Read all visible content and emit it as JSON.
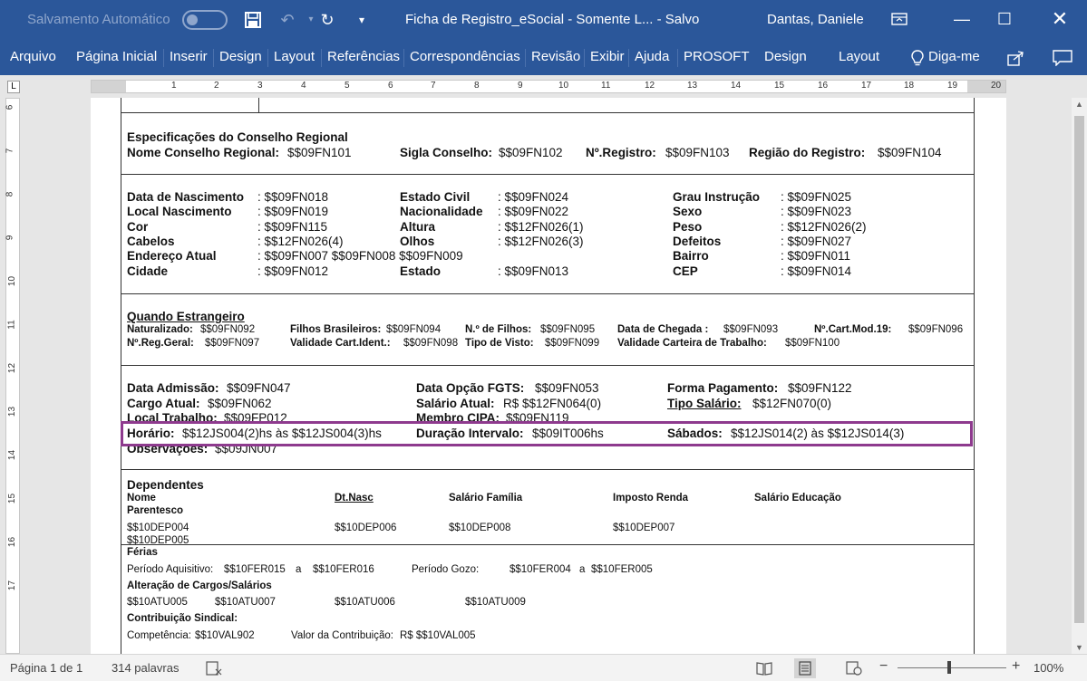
{
  "titlebar": {
    "autosave_label": "Salvamento Automático",
    "doc_title": "Ficha de Registro_eSocial  -  Somente L...  -  Salvo",
    "user": "Dantas, Daniele",
    "save_icon": "save-icon",
    "undo_icon": "undo-icon",
    "redo_icon": "redo-icon",
    "qat_more_icon": "customize-qat-icon"
  },
  "tabs": [
    "Arquivo",
    "Página Inicial",
    "Inserir",
    "Design",
    "Layout",
    "Referências",
    "Correspondências",
    "Revisão",
    "Exibir",
    "Ajuda",
    "PROSOFT",
    "Design",
    "Layout"
  ],
  "tell_me": "Diga-me",
  "ruler": {
    "h_numbers": [
      "1",
      "2",
      "3",
      "4",
      "5",
      "6",
      "7",
      "8",
      "9",
      "10",
      "11",
      "12",
      "13",
      "14",
      "15",
      "16",
      "17",
      "18",
      "19",
      "20"
    ],
    "v_numbers": [
      "6",
      "7",
      "8",
      "9",
      "10",
      "11",
      "12",
      "13",
      "14",
      "15",
      "16",
      "17"
    ]
  },
  "conselho": {
    "title": "Especificações do Conselho Regional",
    "nome_label": "Nome Conselho Regional:",
    "nome_value": "$$09FN101",
    "sigla_label": "Sigla Conselho:",
    "sigla_value": "$$09FN102",
    "registro_label": "Nº.Registro:",
    "registro_value": "$$09FN103",
    "regiao_label": "Região do Registro:",
    "regiao_value": "$$09FN104"
  },
  "pessoais": {
    "col1": [
      {
        "label": "Data de Nascimento",
        "value": ": $$09FN018"
      },
      {
        "label": "Local Nascimento",
        "value": ": $$09FN019"
      },
      {
        "label": "Cor",
        "value": ": $$09FN115"
      },
      {
        "label": "Cabelos",
        "value": ": $$12FN026(4)"
      },
      {
        "label": "Endereço Atual",
        "value": ": $$09FN007 $$09FN008 $$09FN009"
      },
      {
        "label": "Cidade",
        "value": ": $$09FN012"
      }
    ],
    "col2": [
      {
        "label": "Estado Civil",
        "value": ": $$09FN024"
      },
      {
        "label": "Nacionalidade",
        "value": ": $$09FN022"
      },
      {
        "label": "Altura",
        "value": ": $$12FN026(1)"
      },
      {
        "label": "Olhos",
        "value": ": $$12FN026(3)"
      },
      {
        "label": "Estado",
        "value": ": $$09FN013"
      }
    ],
    "col3": [
      {
        "label": "Grau Instrução",
        "value": ": $$09FN025"
      },
      {
        "label": "Sexo",
        "value": ": $$09FN023"
      },
      {
        "label": "Peso",
        "value": ": $$12FN026(2)"
      },
      {
        "label": "Defeitos",
        "value": ": $$09FN027"
      },
      {
        "label": "Bairro",
        "value": ": $$09FN011"
      },
      {
        "label": "CEP",
        "value": ": $$09FN014"
      }
    ]
  },
  "estrangeiro": {
    "title": "Quando Estrangeiro",
    "naturalizado_label": "Naturalizado:",
    "naturalizado_value": "$$09FN092",
    "filhos_br_label": "Filhos Brasileiros:",
    "filhos_br_value": "$$09FN094",
    "num_filhos_label": "N.º de Filhos:",
    "num_filhos_value": "$$09FN095",
    "chegada_label": "Data de Chegada :",
    "chegada_value": "$$09FN093",
    "cart_label": "Nº.Cart.Mod.19:",
    "cart_value": "$$09FN096",
    "reg_geral_label": "Nº.Reg.Geral:",
    "reg_geral_value": "$$09FN097",
    "validade_ident_label": "Validade Cart.Ident.:",
    "validade_ident_value": "$$09FN098",
    "tipo_visto_label": "Tipo de Visto:",
    "tipo_visto_value": "$$09FN099",
    "validade_trab_label": "Validade Carteira de Trabalho:",
    "validade_trab_value": "$$09FN100"
  },
  "contrato": {
    "admissao_label": "Data Admissão:",
    "admissao_value": "$$09FN047",
    "fgts_label": "Data Opção FGTS:",
    "fgts_value": "$$09FN053",
    "pagamento_label": "Forma Pagamento:",
    "pagamento_value": "$$09FN122",
    "cargo_label": "Cargo Atual:",
    "cargo_value": "$$09FN062",
    "salario_label": "Salário Atual:",
    "salario_value": "R$ $$12FN064(0)",
    "tipo_salario_label": "Tipo  Salário:",
    "tipo_salario_value": "$$12FN070(0)",
    "local_label": "Local Trabalho:",
    "local_value": "$$09FP012",
    "cipa_label": "Membro CIPA:",
    "cipa_value": "$$09FN119",
    "horario_label": "Horário:",
    "horario_value": "$$12JS004(2)hs às $$12JS004(3)hs",
    "intervalo_label": "Duração Intervalo:",
    "intervalo_value": "$$09IT006hs",
    "sabados_label": "Sábados:",
    "sabados_value": "$$12JS014(2) às $$12JS014(3)",
    "obs_label": "Observações:",
    "obs_value": "$$09JN007"
  },
  "dependentes": {
    "title": "Dependentes",
    "headers": [
      "Nome",
      "Dt.Nasc",
      "Salário Família",
      "Imposto Renda",
      "Salário Educação"
    ],
    "parentesco_label": "Parentesco",
    "row": [
      "$$10DEP004",
      "$$10DEP006",
      "$$10DEP008",
      "$$10DEP007"
    ],
    "row2": "$$10DEP005"
  },
  "ferias": {
    "title": "Férias",
    "aquisitivo_label": "Período Aquisitivo:",
    "aquisitivo_from": "$$10FER015",
    "a1": "a",
    "aquisitivo_to": "$$10FER016",
    "gozo_label": "Período Gozo:",
    "gozo_from": "$$10FER004",
    "a2": "a",
    "gozo_to": "$$10FER005"
  },
  "alteracao": {
    "title": "Alteração de Cargos/Salários",
    "values": [
      "$$10ATU005",
      "$$10ATU007",
      "$$10ATU006",
      "$$10ATU009"
    ]
  },
  "sindical": {
    "title": "Contribuição Sindical:",
    "competencia_label": "Competência:",
    "competencia_value": "$$10VAL902",
    "valor_label": "Valor da Contribuição:",
    "valor_value": "R$ $$10VAL005"
  },
  "statusbar": {
    "page": "Página 1 de 1",
    "words": "314 palavras",
    "zoom": "100%",
    "zoom_level_percent": 100
  }
}
